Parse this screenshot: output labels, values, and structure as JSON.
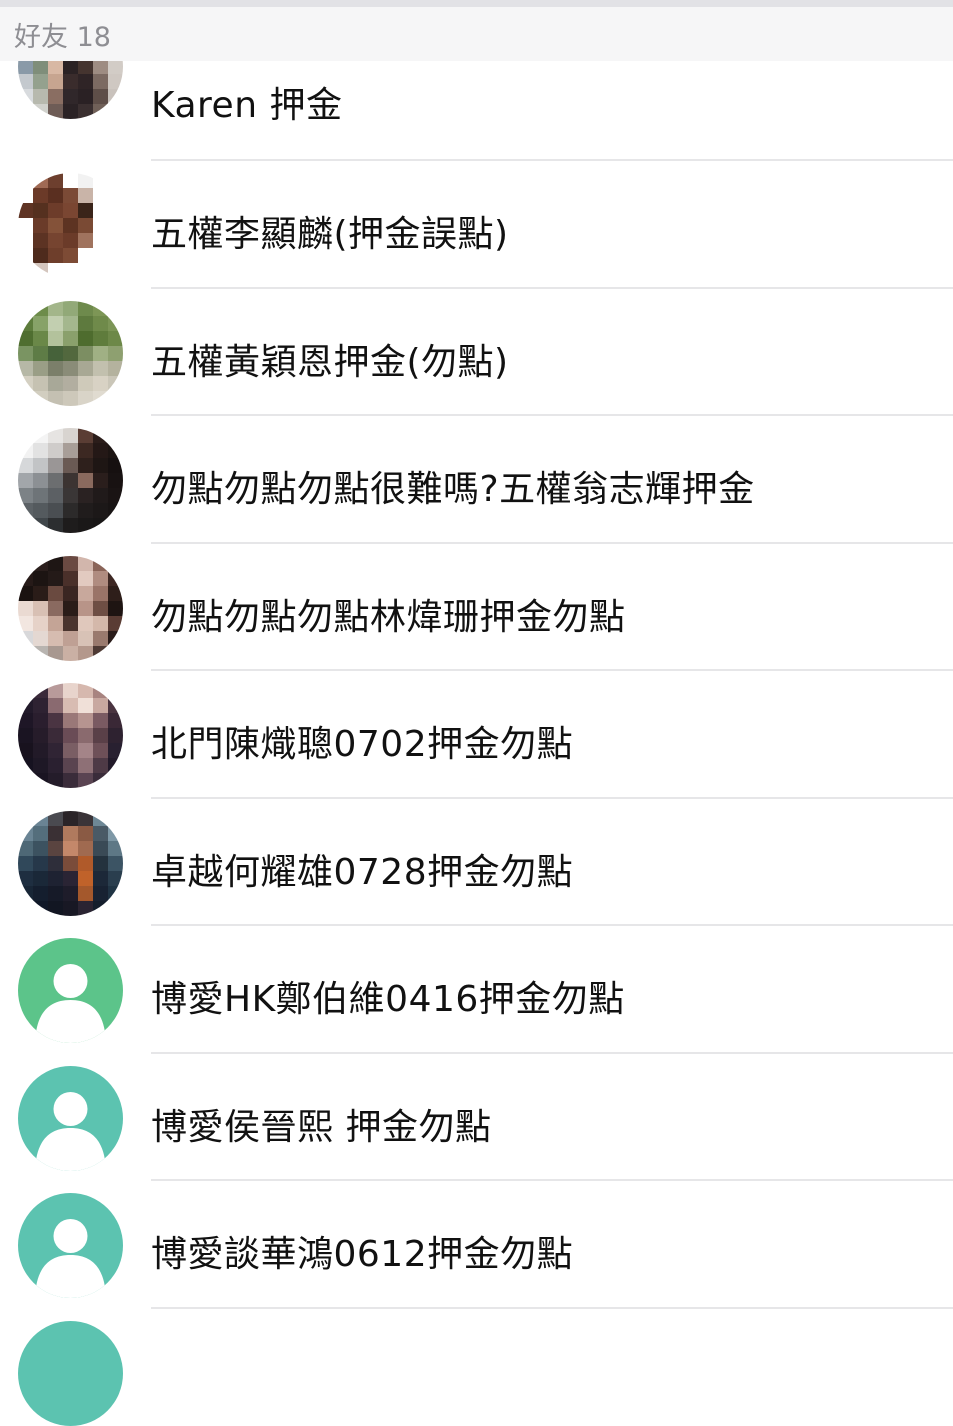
{
  "header": {
    "label": "好友 18"
  },
  "contacts": [
    {
      "name": "Karen 押金",
      "avatar": "photo"
    },
    {
      "name": "五權李顯麟(押金誤點)",
      "avatar": "photo"
    },
    {
      "name": "五權黃穎恩押金(勿點)",
      "avatar": "photo"
    },
    {
      "name": "勿點勿點勿點很難嗎?五權翁志輝押金",
      "avatar": "photo"
    },
    {
      "name": "勿點勿點勿點林煒珊押金勿點",
      "avatar": "photo"
    },
    {
      "name": "北門陳熾聰0702押金勿點",
      "avatar": "photo"
    },
    {
      "name": "卓越何耀雄0728押金勿點",
      "avatar": "photo"
    },
    {
      "name": "博愛HK鄭伯維0416押金勿點",
      "avatar": "default-user-icon"
    },
    {
      "name": "博愛侯晉熙 押金勿點",
      "avatar": "default-user-icon"
    },
    {
      "name": "博愛談華鴻0612押金勿點",
      "avatar": "default-user-icon"
    }
  ],
  "colors": {
    "default_avatar_green": "#5cc48a",
    "default_avatar_teal": "#5cc3b0",
    "header_text": "#8e8e93",
    "divider": "#e6e6e8"
  }
}
